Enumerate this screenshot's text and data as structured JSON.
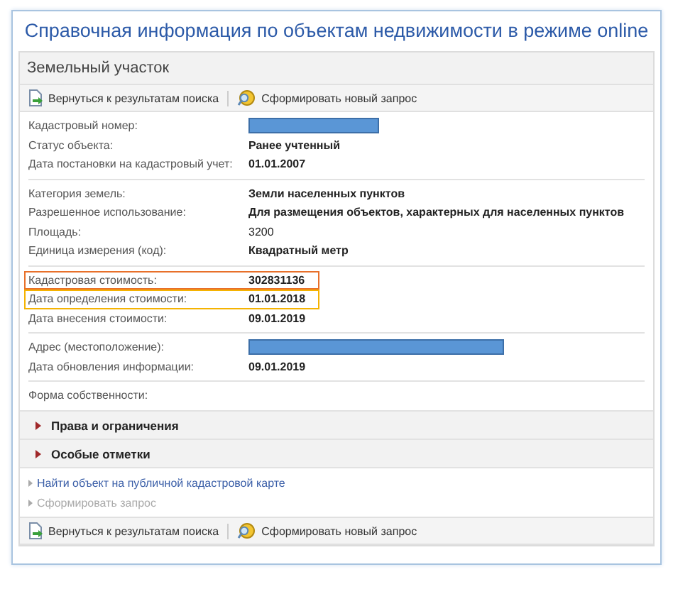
{
  "title": "Справочная информация по объектам недвижимости в режиме online",
  "panel": {
    "heading": "Земельный участок"
  },
  "toolbar_top": [
    {
      "kind": "back",
      "label": "Вернуться к результатам поиска"
    },
    {
      "kind": "new",
      "label": "Сформировать новый запрос"
    }
  ],
  "groups": [
    {
      "rows": [
        {
          "label": "Кадастровый номер:",
          "redacted": true
        },
        {
          "label": "Статус объекта:",
          "value": "Ранее учтенный",
          "bold": true
        },
        {
          "label": "Дата постановки на кадастровый учет:",
          "value": "01.01.2007",
          "bold": true
        }
      ]
    },
    {
      "rows": [
        {
          "label": "Категория земель:",
          "value": "Земли населенных пунктов",
          "bold": true
        },
        {
          "label": "Разрешенное использование:",
          "value": "Для размещения объектов, характерных для населенных пунктов",
          "bold": true
        },
        {
          "label": "Площадь:",
          "value": "3200",
          "bold": false
        },
        {
          "label": "Единица измерения (код):",
          "value": "Квадратный метр",
          "bold": true
        }
      ]
    },
    {
      "rows": [
        {
          "label": "Кадастровая стоимость:",
          "value": "302831136",
          "bold": true,
          "color": "#e8702a"
        },
        {
          "label": "Дата определения стоимости:",
          "value": "01.01.2018",
          "bold": true,
          "color": "#f5b301"
        },
        {
          "label": "Дата внесения стоимости:",
          "value": "09.01.2019",
          "bold": true
        }
      ]
    },
    {
      "rows": [
        {
          "label": "Адрес (местоположение):",
          "redacted": true
        },
        {
          "label": "Дата обновления информации:",
          "value": "09.01.2019",
          "bold": true
        }
      ]
    }
  ],
  "ownership": {
    "label": "Форма собственности:"
  },
  "sections": [
    {
      "title": "Права и ограничения",
      "expanded": false
    },
    {
      "title": "Особые отметки",
      "expanded": false
    }
  ],
  "links": [
    {
      "label": "Найти объект на публичной кадастровой карте",
      "disabled": false
    },
    {
      "label": "Сформировать запрос",
      "disabled": true
    }
  ],
  "toolbar_bottom": [
    {
      "kind": "back",
      "label": "Вернуться к результатам поиска"
    },
    {
      "kind": "new",
      "label": "Сформировать новый запрос"
    }
  ]
}
